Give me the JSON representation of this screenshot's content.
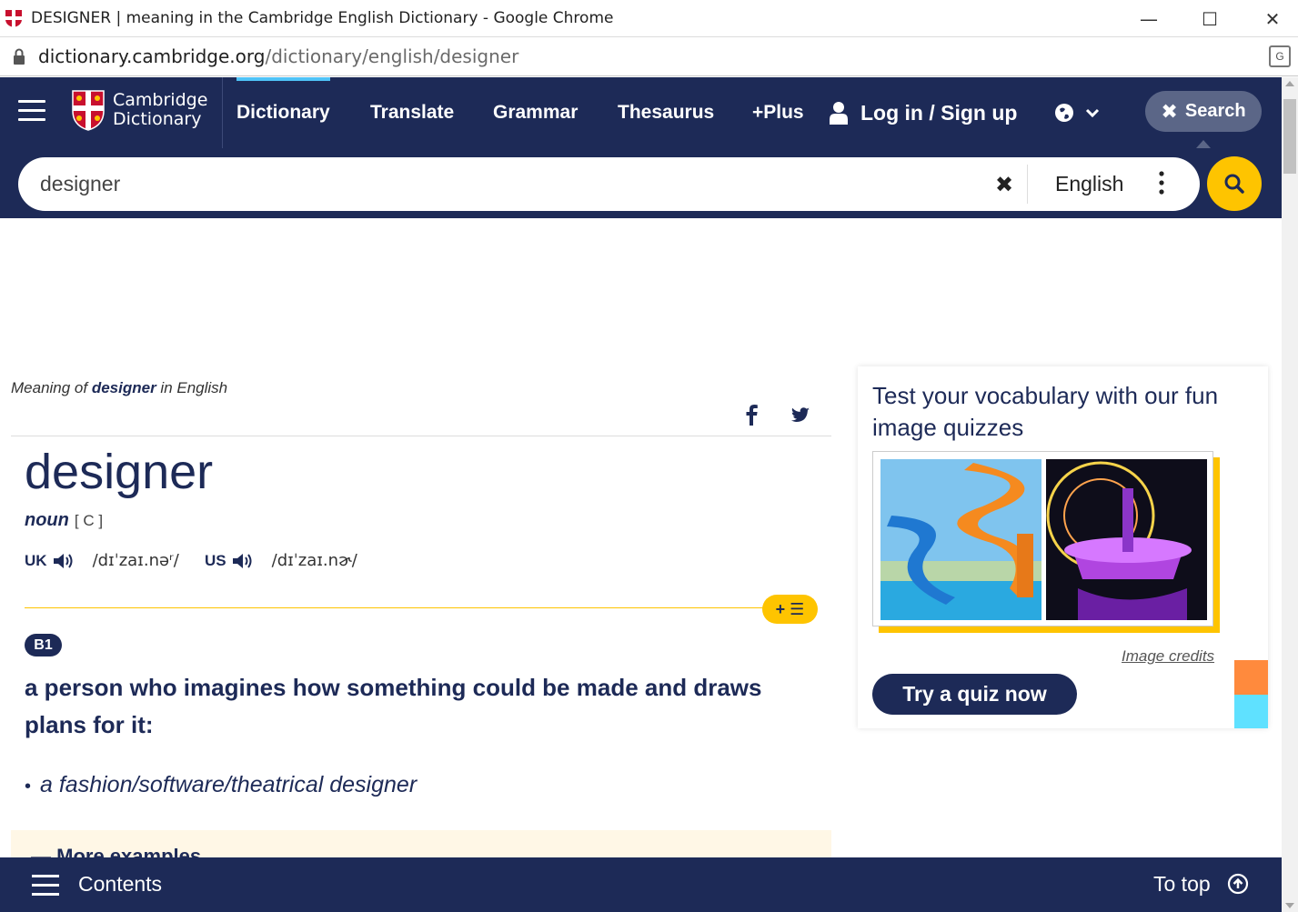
{
  "window": {
    "title": "DESIGNER | meaning in the Cambridge English Dictionary - Google Chrome",
    "minimize": "—",
    "maximize": "☐",
    "close": "✕"
  },
  "address": {
    "host": "dictionary.cambridge.org",
    "path": "/dictionary/english/designer"
  },
  "header": {
    "logo_line1": "Cambridge",
    "logo_line2": "Dictionary",
    "nav": [
      "Dictionary",
      "Translate",
      "Grammar",
      "Thesaurus",
      "+Plus"
    ],
    "login": "Log in",
    "login_sep": " / ",
    "signup": "Sign up",
    "search_button": "Search"
  },
  "search": {
    "query": "designer",
    "language": "English"
  },
  "entry": {
    "meaning_prefix": "Meaning of ",
    "meaning_word": "designer",
    "meaning_suffix": " in English",
    "headword": "designer",
    "pos": "noun",
    "grammar_code": "[ C ]",
    "uk_label": "UK",
    "uk_ipa": "/dɪˈzaɪ.nəʳ/",
    "us_label": "US",
    "us_ipa": "/dɪˈzaɪ.nɚ/",
    "add_list": "+ ☰",
    "level": "B1",
    "definition": "a person who imagines how something could be made and draws plans for it:",
    "example": "a fashion/software/theatrical designer",
    "more_examples": "More examples"
  },
  "quiz": {
    "title": "Test your vocabulary with our fun image quizzes",
    "credits": "Image credits",
    "button": "Try a quiz now"
  },
  "bottom": {
    "contents": "Contents",
    "to_top": "To top"
  },
  "colors": {
    "navy": "#1d2a57",
    "yellow": "#fec400",
    "accent_blue": "#4fc3f7",
    "orange": "#ff8a3d",
    "cyan": "#5fe1ff"
  }
}
